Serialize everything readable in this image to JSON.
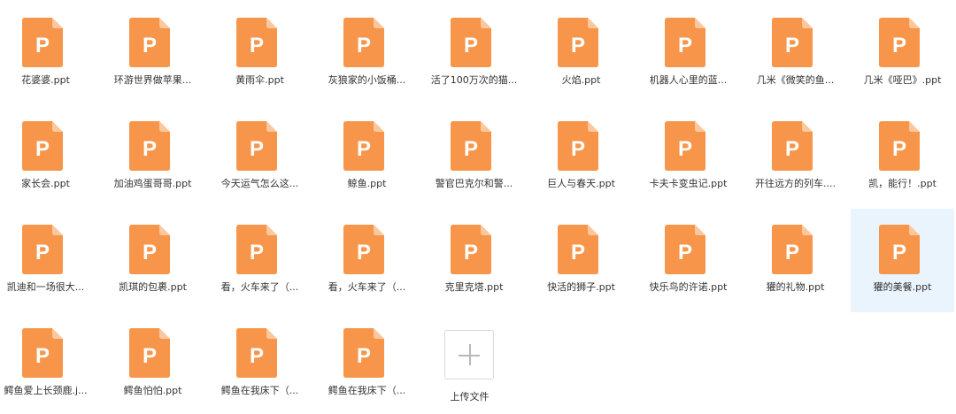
{
  "files": [
    {
      "name": "花婆婆.ppt"
    },
    {
      "name": "环游世界做苹果..."
    },
    {
      "name": "黄雨伞.ppt"
    },
    {
      "name": "灰狼家的小饭桶..."
    },
    {
      "name": "活了100万次的猫..."
    },
    {
      "name": "火焰.ppt"
    },
    {
      "name": "机器人心里的蓝..."
    },
    {
      "name": "几米《微笑的鱼..."
    },
    {
      "name": "几米《哑巴》.ppt"
    },
    {
      "name": "家长会.ppt"
    },
    {
      "name": "加油鸡蛋哥哥.ppt"
    },
    {
      "name": "今天运气怎么这..."
    },
    {
      "name": "鲸鱼.ppt"
    },
    {
      "name": "警官巴克尔和警..."
    },
    {
      "name": "巨人与春天.ppt"
    },
    {
      "name": "卡夫卡变虫记.ppt"
    },
    {
      "name": "开往远方的列车...."
    },
    {
      "name": "凯，能行！.ppt"
    },
    {
      "name": "凯迪和一场很大..."
    },
    {
      "name": "凯琪的包裹.ppt"
    },
    {
      "name": "看，火车来了（..."
    },
    {
      "name": "看，火车来了（..."
    },
    {
      "name": "克里克塔.ppt"
    },
    {
      "name": "快活的狮子.ppt"
    },
    {
      "name": "快乐鸟的许诺.ppt"
    },
    {
      "name": "獾的礼物.ppt"
    },
    {
      "name": "獾的美餐.ppt",
      "selected": true
    },
    {
      "name": "鳄鱼爱上长颈鹿.j..."
    },
    {
      "name": "鳄鱼怕怕.ppt"
    },
    {
      "name": "鳄鱼在我床下（..."
    },
    {
      "name": "鳄鱼在我床下（..."
    }
  ],
  "file_icon": {
    "name": "ppt-file-icon",
    "letter": "P",
    "color": "#f7964a",
    "fold_color": "#fbc79c"
  },
  "upload": {
    "label": "上传文件",
    "icon": "plus-icon"
  }
}
